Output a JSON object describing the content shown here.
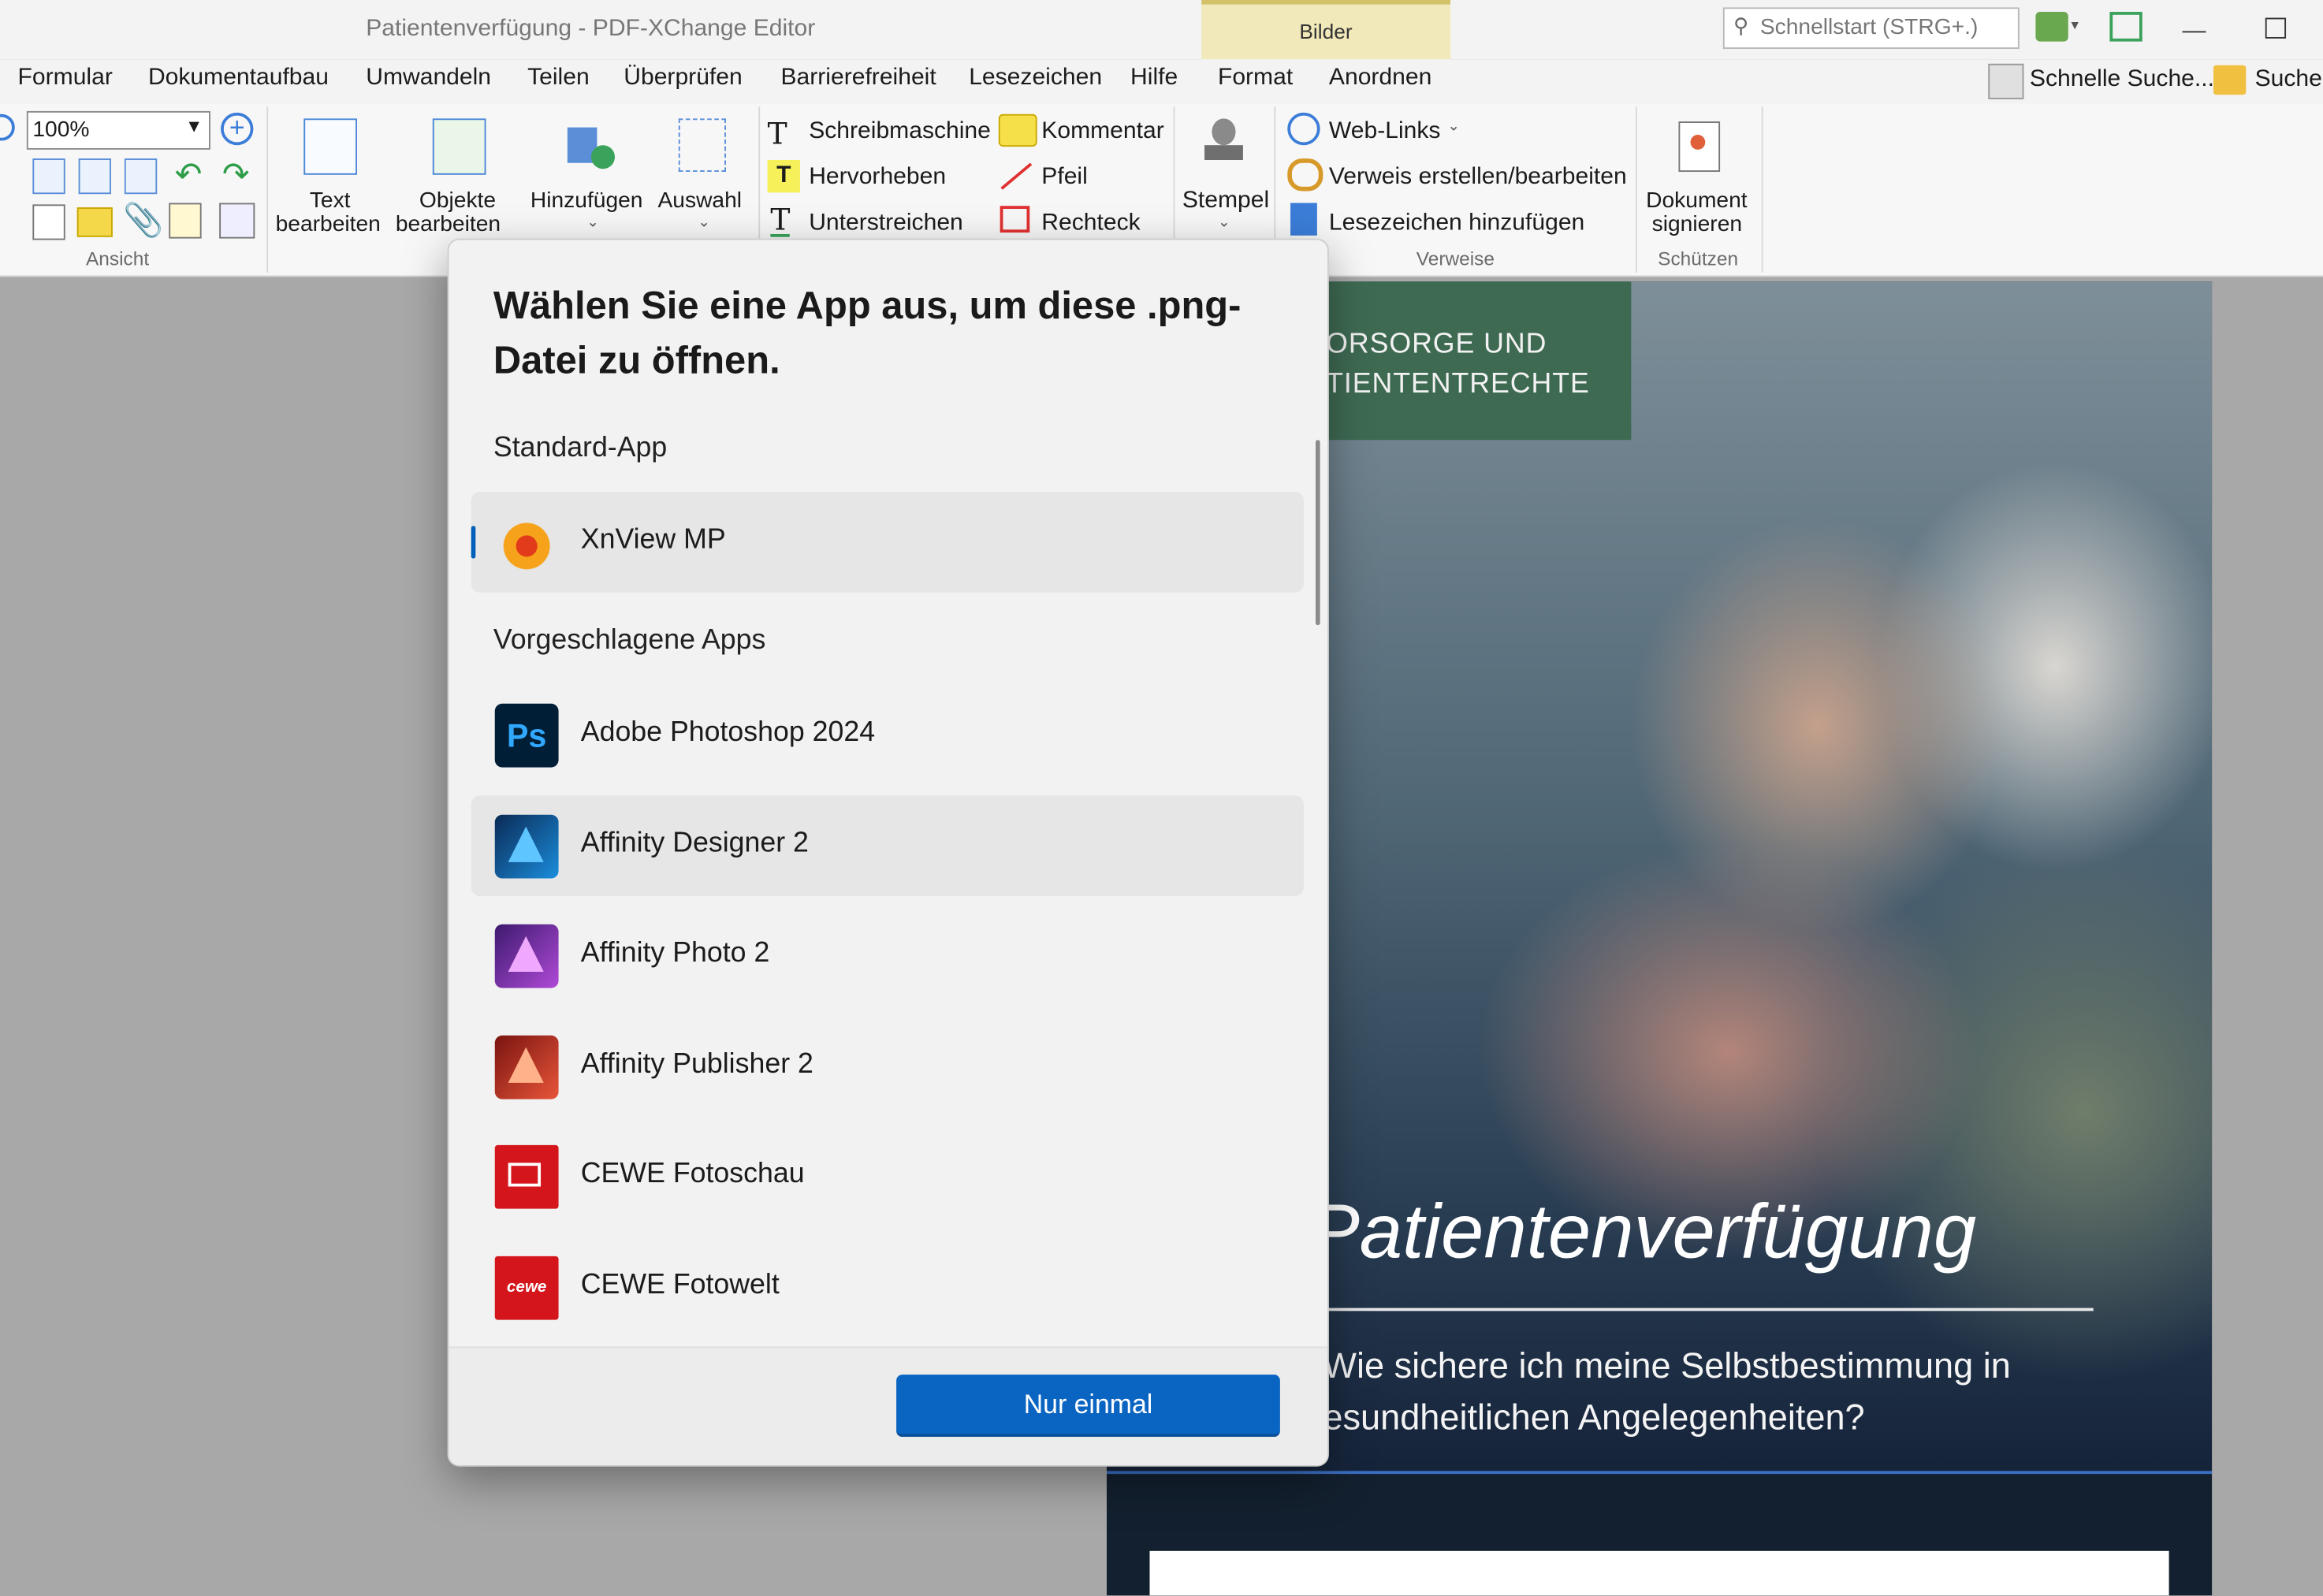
{
  "window": {
    "title": "Patientenverfügung - PDF-XChange Editor",
    "context_tab_group": "Bilder",
    "quickstart_placeholder": "Schnellstart (STRG+.)",
    "quick_search": "Schnelle Suche...",
    "search_short": "Suchen"
  },
  "menu": [
    "Formular",
    "Dokumentaufbau",
    "Umwandeln",
    "Teilen",
    "Überprüfen",
    "Barrierefreiheit",
    "Lesezeichen",
    "Hilfe",
    "Format",
    "Anordnen"
  ],
  "ribbon": {
    "zoom_value": "100%",
    "group_ansicht": "Ansicht",
    "text_bearbeiten_1": "Text",
    "text_bearbeiten_2": "bearbeiten",
    "objekte_bearbeiten_1": "Objekte",
    "objekte_bearbeiten_2": "bearbeiten",
    "hinzufuegen": "Hinzufügen",
    "auswahl": "Auswahl",
    "schreibmaschine": "Schreibmaschine",
    "hervorheben": "Hervorheben",
    "unterstreichen": "Unterstreichen",
    "kommentar": "Kommentar",
    "pfeil": "Pfeil",
    "rechteck": "Rechteck",
    "stempel": "Stempel",
    "web_links": "Web-Links",
    "verweis": "Verweis erstellen/bearbeiten",
    "lesezeichen_hinzu": "Lesezeichen hinzufügen",
    "group_verweise": "Verweise",
    "dokument_signieren_1": "Dokument",
    "dokument_signieren_2": "signieren",
    "group_schuetzen": "Schützen"
  },
  "document": {
    "header_line1": "ORSORGE UND",
    "header_line2": "TIENTENTRECHTE",
    "title": "Patientenverfügung",
    "subtitle_line1": "Wie sichere ich meine Selbstbestimmung in",
    "subtitle_line2": "esundheitlichen Angelegenheiten?"
  },
  "dialog": {
    "title": "Wählen Sie eine App aus, um diese .png-Datei zu öffnen.",
    "default_section": "Standard-App",
    "default_app": "XnView MP",
    "suggested_section": "Vorgeschlagene Apps",
    "apps": [
      "Adobe Photoshop 2024",
      "Affinity Designer 2",
      "Affinity Photo 2",
      "Affinity Publisher 2",
      "CEWE Fotoschau",
      "CEWE Fotowelt"
    ],
    "button_once": "Nur einmal"
  },
  "colors": {
    "accent": "#0a64c2",
    "selection_bar": "#005fb8",
    "context_tab": "#f1e9b9",
    "doc_green": "#3e6a52"
  },
  "icons": {
    "xnview": "xnview-mp-icon",
    "photoshop": "photoshop-icon",
    "designer": "affinity-designer-icon",
    "photo": "affinity-photo-icon",
    "publisher": "affinity-publisher-icon",
    "cewe_fotoschau": "cewe-fotoschau-icon",
    "cewe_fotowelt": "cewe-fotowelt-icon"
  }
}
